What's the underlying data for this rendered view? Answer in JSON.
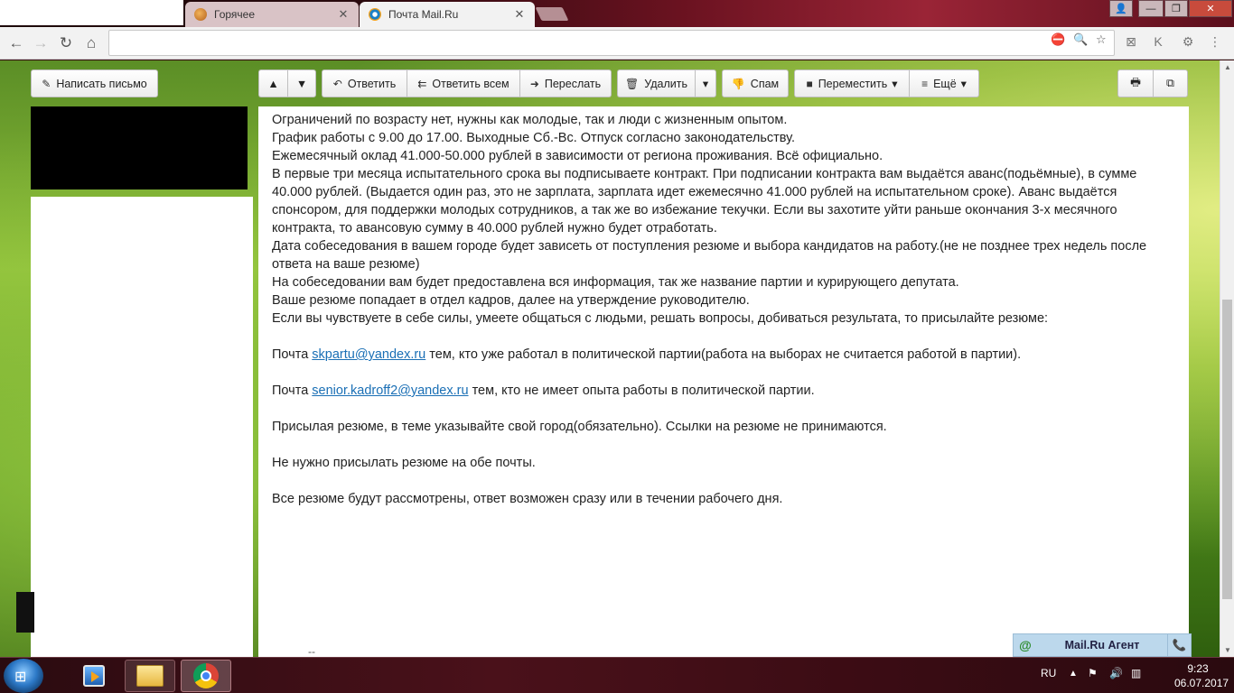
{
  "browser": {
    "tabs": [
      {
        "title": "Горячее",
        "close": "✕"
      },
      {
        "title": "Почта Mail.Ru",
        "close": "✕"
      }
    ],
    "window_controls": {
      "user": "👤",
      "minimize": "—",
      "maximize": "❐",
      "close": "✕"
    },
    "nav": {
      "back": "←",
      "forward": "→",
      "reload": "↻",
      "home": "⌂"
    },
    "omnibox": {
      "value": ""
    }
  },
  "mail_toolbar": {
    "compose": "Написать письмо",
    "prev": "▲",
    "next": "▼",
    "reply": "Ответить",
    "reply_all": "Ответить всем",
    "forward": "Переслать",
    "delete": "Удалить",
    "delete_more": "▾",
    "spam": "Спам",
    "move": "Переместить",
    "more": "Ещё",
    "caret": "▾"
  },
  "message": {
    "lines": [
      "Ограничений по возрасту нет, нужны как молодые, так и люди с жизненным опытом.",
      "График работы с 9.00 до 17.00. Выходные Сб.-Вс. Отпуск согласно законодательству.",
      "Ежемесячный оклад 41.000-50.000 рублей в зависимости от региона проживания. Всё официально.",
      "В первые три месяца испытательного срока вы подписываете контракт. При подписании контракта вам выдаётся аванс(подьёмные), в сумме 40.000 рублей. (Выдается один раз, это не зарплата, зарплата идет ежемесячно 41.000 рублей на испытательном сроке). Аванс выдаётся спонсором, для поддержки молодых сотрудников, а так же во избежание текучки. Если вы захотите уйти раньше окончания 3-х месячного контракта, то авансовую сумму в 40.000 рублей нужно будет отработать.",
      "Дата собеседования в вашем городе будет зависеть от поступления резюме и выбора кандидатов на работу.(не не позднее трех недель после ответа на ваше резюме)",
      "На собеседовании вам будет предоставлена вся информация, так же название партии и курирующего депутата.",
      "Ваше резюме попадает в отдел кадров, далее на утверждение руководителю.",
      "Если вы чувствуете в себе силы, умеете общаться с людьми, решать вопросы, добиваться результата, то присылайте резюме:"
    ],
    "mail1": {
      "prefix": "Почта ",
      "email": "skpartu@yandex.ru",
      "suffix": " тем, кто уже работал в политической партии(работа на выборах не считается работой в партии)."
    },
    "mail2": {
      "prefix": "Почта ",
      "email": "senior.kadroff2@yandex.ru",
      "suffix": " тем, кто не имеет опыта работы в политической партии."
    },
    "note1": "Присылая резюме, в теме указывайте свой город(обязательно). Ссылки на резюме не принимаются.",
    "note2": "Не нужно присылать резюме на обе почты.",
    "note3": "Все резюме будут рассмотрены, ответ возможен сразу или в течении рабочего дня.",
    "signature": "--"
  },
  "agent": {
    "at": "@",
    "title": "Mail.Ru Агент",
    "phone": "📞"
  },
  "taskbar": {
    "lang": "RU",
    "time": "9:23",
    "date": "06.07.2017"
  },
  "colors": {
    "link": "#1a6fb5",
    "agent_bg": "#bcd8ec",
    "taskbar": "#3b0c14"
  }
}
